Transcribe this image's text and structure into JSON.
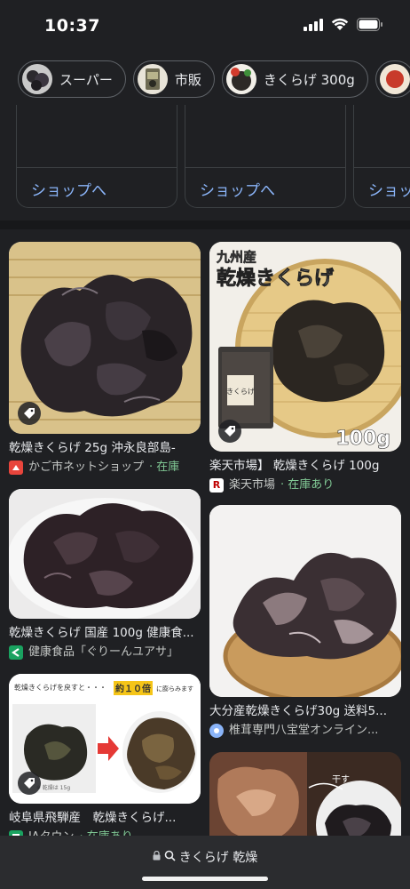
{
  "status_bar": {
    "time": "10:37"
  },
  "chips": [
    {
      "label": "スーパー"
    },
    {
      "label": "市販"
    },
    {
      "label": "きくらげ 300g"
    }
  ],
  "shop_cards": [
    {
      "label": "ショップへ"
    },
    {
      "label": "ショップへ"
    },
    {
      "label": "ショップへ"
    }
  ],
  "results": [
    {
      "title": "乾燥きくらげ 25g 沖永良部島-",
      "source": "かご市ネットショップ",
      "stock": " · 在庫",
      "source_color": "#e8453c",
      "icon_text": ""
    },
    {
      "title": "楽天市場】 乾燥きくらげ 100g",
      "source": "楽天市場",
      "stock": " · 在庫あり",
      "source_color": "#ffffff",
      "icon_text": "R"
    },
    {
      "title": "乾燥きくらげ 国産 100g 健康食...",
      "source": "健康食品「ぐりーんユアサ」",
      "stock": "",
      "source_color": "#1aa260",
      "icon_text": ""
    },
    {
      "title": "大分産乾燥きくらげ30g 送料5...",
      "source": "椎茸専門八宝堂オンライン...",
      "stock": "",
      "source_color": "#8ab4f8",
      "icon_text": ""
    },
    {
      "title": "岐阜県飛騨産　乾燥きくらげ...",
      "source": "JAタウン",
      "stock": " · 在庫あり",
      "source_color": "#1aa260",
      "icon_text": ""
    }
  ],
  "image_text": {
    "kyushu": "九州産",
    "kansou_kikurage": "乾燥きくらげ",
    "package": "きくらげ",
    "weight": "100g",
    "soak_note": "乾燥きくらげを戻すと・・・",
    "ten_times": "約１０倍",
    "swell_note": "に膨らみます",
    "weight_note": "※ 乾燥は 15g",
    "dry_label": "干す"
  },
  "bottom_bar": {
    "url": "きくらげ 乾燥"
  },
  "colors": {
    "background": "#1f2023",
    "link": "#8ab4f8",
    "stock": "#81c995"
  }
}
